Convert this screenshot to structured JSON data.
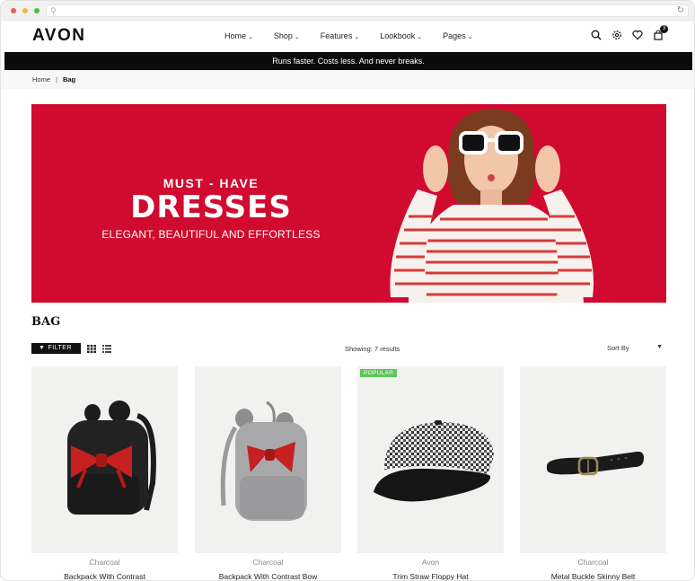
{
  "header": {
    "logo": "AVON",
    "nav": [
      {
        "label": "Home"
      },
      {
        "label": "Shop"
      },
      {
        "label": "Features"
      },
      {
        "label": "Lookbook"
      },
      {
        "label": "Pages"
      }
    ],
    "cart_count": "3"
  },
  "announcement": "Runs faster. Costs less. And never breaks.",
  "breadcrumb": {
    "home": "Home",
    "separator": "|",
    "current": "Bag"
  },
  "banner": {
    "top": "MUST - HAVE",
    "main": "DRESSES",
    "sub": "ELEGANT, BEAUTIFUL AND EFFORTLESS",
    "background": "#d10a2f"
  },
  "category": {
    "title": "BAG"
  },
  "toolbar": {
    "filter_label": "FILTER",
    "showing": "Showing: 7 results",
    "sort_label": "Sort By"
  },
  "products": [
    {
      "vendor": "Charcoal",
      "title": "Backpack With Contrast",
      "badge": ""
    },
    {
      "vendor": "Charcoal",
      "title": "Backpack With Contrast Bow",
      "badge": ""
    },
    {
      "vendor": "Avon",
      "title": "Trim Straw Floppy Hat",
      "badge": "POPULAR"
    },
    {
      "vendor": "Charcoal",
      "title": "Metal Buckle Skinny Belt",
      "badge": ""
    }
  ],
  "colors": {
    "accent": "#d10a2f",
    "badge": "#5cc65a",
    "dark": "#0b0b0b"
  }
}
